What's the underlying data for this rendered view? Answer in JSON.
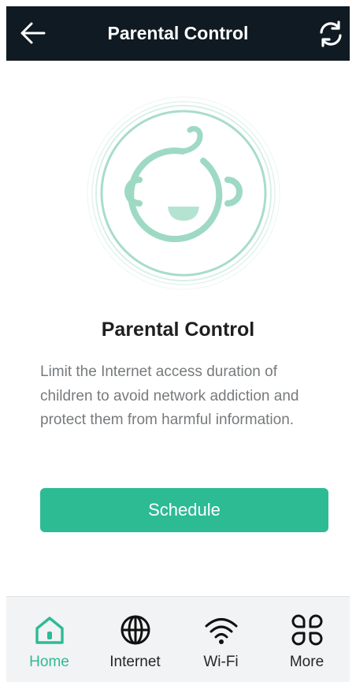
{
  "header": {
    "title": "Parental Control",
    "back_icon": "arrow-left-icon",
    "refresh_icon": "refresh-icon"
  },
  "hero": {
    "icon": "baby-face-icon",
    "accent_color": "#9ed9c4"
  },
  "content": {
    "title": "Parental Control",
    "description": "Limit the Internet access duration of children to avoid network addiction and protect them from harmful information."
  },
  "schedule_button": {
    "label": "Schedule",
    "color": "#2dbb94"
  },
  "tabbar": {
    "active_color": "#2dbb94",
    "tabs": [
      {
        "label": "Home",
        "icon": "home-icon",
        "active": true
      },
      {
        "label": "Internet",
        "icon": "globe-icon",
        "active": false
      },
      {
        "label": "Wi-Fi",
        "icon": "wifi-icon",
        "active": false
      },
      {
        "label": "More",
        "icon": "more-grid-icon",
        "active": false
      }
    ]
  }
}
